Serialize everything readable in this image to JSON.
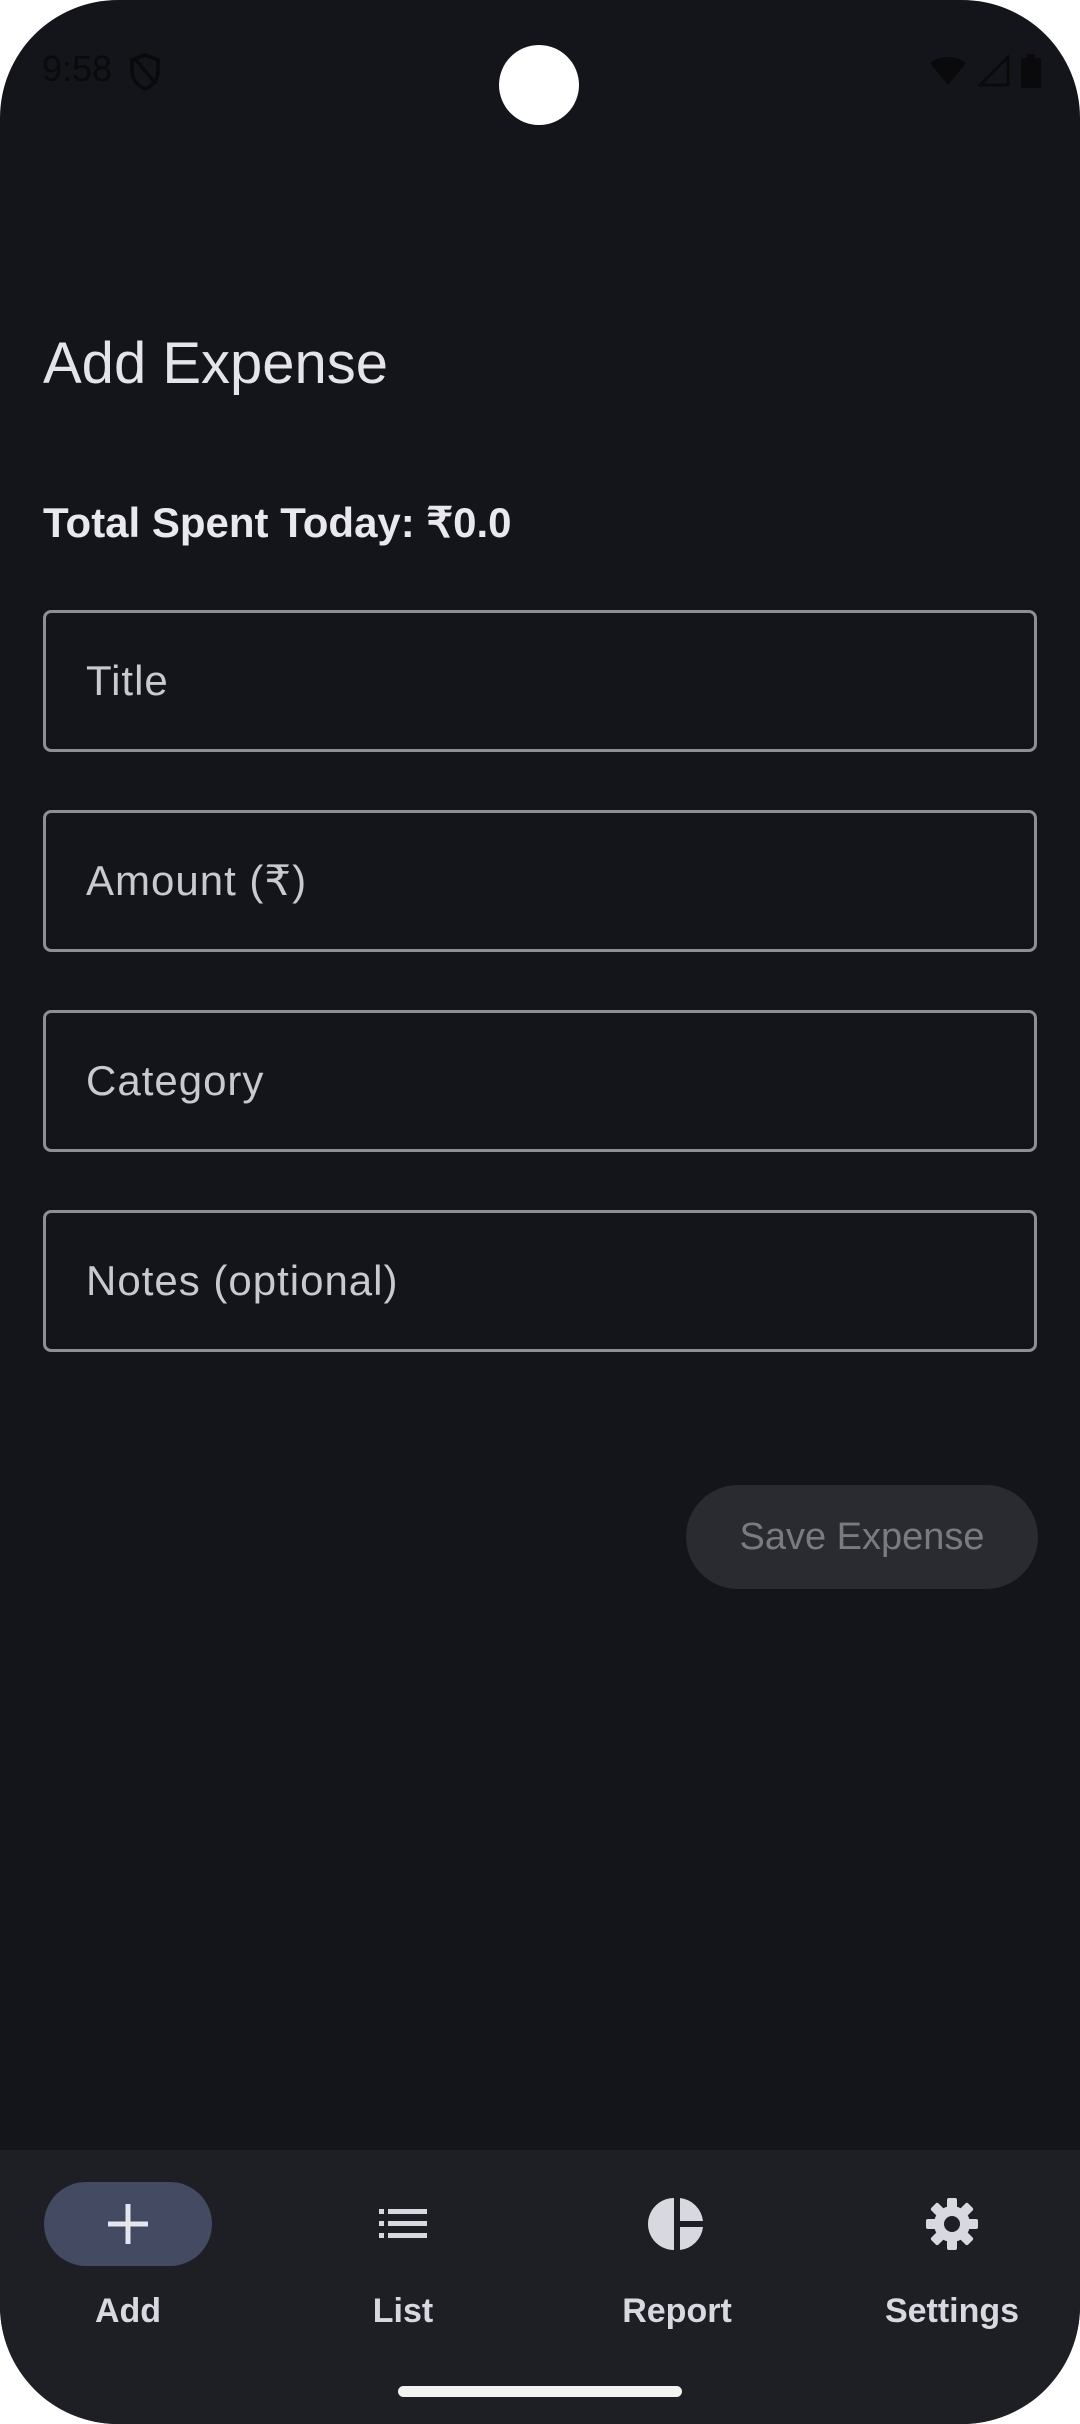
{
  "status_bar": {
    "time": "9:58"
  },
  "header": {
    "title": "Add Expense"
  },
  "summary": {
    "total_spent_today": "Total Spent Today: ₹0.0"
  },
  "form": {
    "title_placeholder": "Title",
    "amount_placeholder": "Amount (₹)",
    "category_placeholder": "Category",
    "notes_placeholder": "Notes (optional)",
    "save_label": "Save Expense"
  },
  "nav": {
    "items": [
      {
        "label": "Add",
        "icon": "plus-icon",
        "active": true
      },
      {
        "label": "List",
        "icon": "list-icon",
        "active": false
      },
      {
        "label": "Report",
        "icon": "pie-chart-icon",
        "active": false
      },
      {
        "label": "Settings",
        "icon": "gear-icon",
        "active": false
      }
    ]
  },
  "colors": {
    "background": "#14151a",
    "nav_background": "#1e1f25",
    "active_pill": "#434a61",
    "field_border": "#8e8f96",
    "disabled_button": "#2a2b30"
  }
}
